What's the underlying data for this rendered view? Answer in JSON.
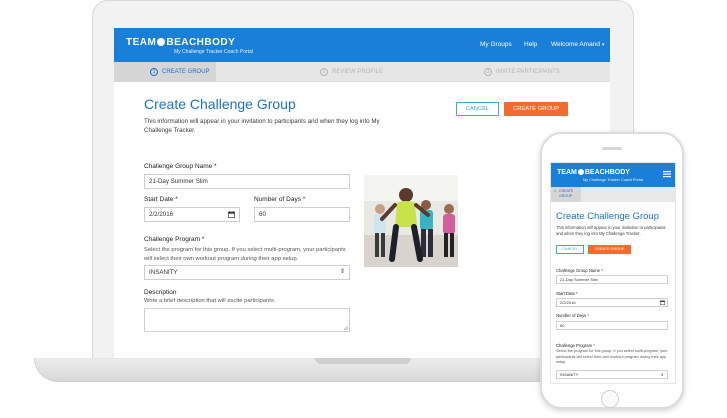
{
  "laptop": {
    "header": {
      "logo_left": "TEAM",
      "logo_right": "BEACHBODY",
      "tagline": "My Challenge Tracker Coach Portal",
      "nav": {
        "my_groups": "My Groups",
        "help": "Help",
        "welcome": "Welcome Amand"
      }
    },
    "steps": [
      {
        "number": "1",
        "label": "CREATE GROUP"
      },
      {
        "number": "2",
        "label": "REVIEW PROFILE"
      },
      {
        "number": "3",
        "label": "INVITE PARTICIPANTS"
      }
    ],
    "title": "Create Challenge Group",
    "description": "This information will appear in your invitation to participants and when they log into My Challenge Tracker.",
    "buttons": {
      "cancel": "CANCEL",
      "create": "CREATE GROUP"
    },
    "form": {
      "group_name_label": "Challenge Group Name *",
      "group_name_value": "21-Day Summer Slim",
      "start_date_label": "Start Date *",
      "start_date_value": "2/2/2016",
      "days_label": "Number of Days *",
      "days_value": "60",
      "program_label": "Challenge Program *",
      "program_help": "Select the program for this group. If you select multi-program, your participants will select their own workout program during their app setup.",
      "program_value": "INSANITY",
      "description_label": "Description",
      "description_help": "Write a brief description that will excite participants."
    }
  },
  "phone": {
    "header": {
      "logo_left": "TEAM",
      "logo_right": "BEACHBODY",
      "tagline": "My Challenge Tracker Coach Portal"
    },
    "step": {
      "number": "1",
      "label_line1": "CREATE",
      "label_line2": "GROUP"
    },
    "title": "Create Challenge Group",
    "description": "This information will appear in your invitation to participants and when they log into My Challenge Tracker.",
    "buttons": {
      "cancel": "CANCEL",
      "create": "CREATE GROUP"
    },
    "form": {
      "group_name_label": "Challenge Group Name *",
      "group_name_value": "21-Day Summer Slim",
      "start_date_label": "Start Date *",
      "start_date_value": "2/2/2016",
      "days_label": "Number of Days *",
      "days_value": "60",
      "program_label": "Challenge Program *",
      "program_help": "Select the program for this group. If you select multi-program, your participants will select their own workout program during their app setup.",
      "program_value": "INSANITY"
    }
  },
  "colors": {
    "brand_blue": "#1a7fd6",
    "title_blue": "#1a73c9",
    "accent_orange": "#f26c2e",
    "cancel_blue": "#3ca6d6"
  },
  "icons": [
    "calendar-icon",
    "chevron-down-icon",
    "menu-icon",
    "resize-handle-icon"
  ]
}
